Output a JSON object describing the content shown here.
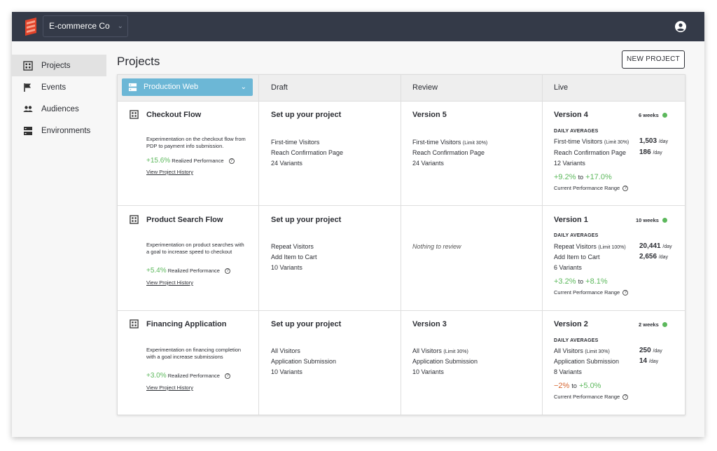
{
  "header": {
    "org_name": "E-commerce Co"
  },
  "sidebar": {
    "items": [
      {
        "label": "Projects",
        "icon": "projects-icon"
      },
      {
        "label": "Events",
        "icon": "flag-icon"
      },
      {
        "label": "Audiences",
        "icon": "people-icon"
      },
      {
        "label": "Environments",
        "icon": "server-icon"
      }
    ]
  },
  "page": {
    "title": "Projects",
    "new_project_label": "NEW PROJECT"
  },
  "board": {
    "environment": "Production Web",
    "columns": {
      "draft": "Draft",
      "review": "Review",
      "live": "Live"
    },
    "common": {
      "realized_performance": "Realized Performance",
      "view_history": "View Project History",
      "daily_averages": "DAILY AVERAGES",
      "per_day": "/day",
      "range_to": "to",
      "range_label": "Current Performance Range"
    },
    "projects": [
      {
        "name": "Checkout Flow",
        "description": "Experimentation on the checkout flow from PDP to payment info submission.",
        "realized": "+15.6%",
        "draft": {
          "title": "Set up your project",
          "audience": "First-time Visitors",
          "goal": "Reach Confirmation Page",
          "variants": "24 Variants"
        },
        "review": {
          "title": "Version 5",
          "audience": "First-time Visitors",
          "limit": "(Limit 30%)",
          "goal": "Reach Confirmation Page",
          "variants": "24 Variants"
        },
        "live": {
          "title": "Version 4",
          "duration": "6 weeks",
          "audience": "First-time Visitors",
          "limit": "(Limit 30%)",
          "audience_value": "1,503",
          "goal": "Reach Confirmation Page",
          "goal_value": "186",
          "variants": "12 Variants",
          "range_low": "+9.2%",
          "range_high": "+17.0%"
        }
      },
      {
        "name": "Product Search Flow",
        "description": "Experimentation on product searches with a goal to increase speed to checkout",
        "realized": "+5.4%",
        "draft": {
          "title": "Set up your project",
          "audience": "Repeat Visitors",
          "goal": "Add Item to Cart",
          "variants": "10 Variants"
        },
        "review": {
          "empty": "Nothing to review"
        },
        "live": {
          "title": "Version 1",
          "duration": "10 weeks",
          "audience": "Repeat Visitors",
          "limit": "(Limit 100%)",
          "audience_value": "20,441",
          "goal": "Add Item to Cart",
          "goal_value": "2,656",
          "variants": "6 Variants",
          "range_low": "+3.2%",
          "range_high": "+8.1%"
        }
      },
      {
        "name": "Financing Application",
        "description": "Experimentation on financing completion with a goal increase submissions",
        "realized": "+3.0%",
        "draft": {
          "title": "Set up your project",
          "audience": "All Visitors",
          "goal": "Application Submission",
          "variants": "10 Variants"
        },
        "review": {
          "title": "Version 3",
          "audience": "All Visitors",
          "limit": "(Limit 30%)",
          "goal": "Application Submission",
          "variants": "10 Variants"
        },
        "live": {
          "title": "Version 2",
          "duration": "2 weeks",
          "audience": "All Visitors",
          "limit": "(Limit 30%)",
          "audience_value": "250",
          "goal": "Application Submission",
          "goal_value": "14",
          "variants": "8 Variants",
          "range_low": "−2%",
          "range_high": "+5.0%"
        }
      }
    ]
  },
  "colors": {
    "topbar": "#343a48",
    "accent": "#6cb7d6",
    "positive": "#5cb85c",
    "negative": "#d5632d"
  }
}
